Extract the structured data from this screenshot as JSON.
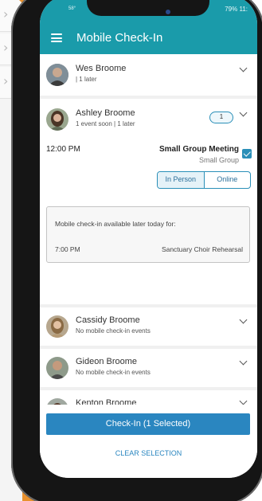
{
  "status_bar": {
    "time": "58°",
    "battery": "79% 11:"
  },
  "header": {
    "title": "Mobile Check-In"
  },
  "people": [
    {
      "name": "Wes Broome",
      "subtitle": "| 1 later"
    },
    {
      "name": "Ashley Broome",
      "subtitle": "1 event soon | 1 later",
      "badge": "1",
      "event": {
        "time": "12:00 PM",
        "name": "Small Group Meeting",
        "type": "Small Group",
        "attendance_options": [
          "In Person",
          "Online"
        ],
        "selected_option": "In Person",
        "checked": true
      },
      "later": {
        "heading": "Mobile check-in available later today for:",
        "time": "7:00 PM",
        "event": "Sanctuary Choir Rehearsal"
      }
    },
    {
      "name": "Cassidy Broome",
      "subtitle": "No mobile check-in events"
    },
    {
      "name": "Gideon Broome",
      "subtitle": "No mobile check-in events"
    },
    {
      "name": "Kenton Broome",
      "subtitle": ""
    }
  ],
  "actions": {
    "checkin_label": "Check-In (1 Selected)",
    "clear_label": "CLEAR SELECTION"
  },
  "colors": {
    "header": "#1a9baa",
    "primary": "#2a86c0",
    "accent": "#e8912e"
  }
}
